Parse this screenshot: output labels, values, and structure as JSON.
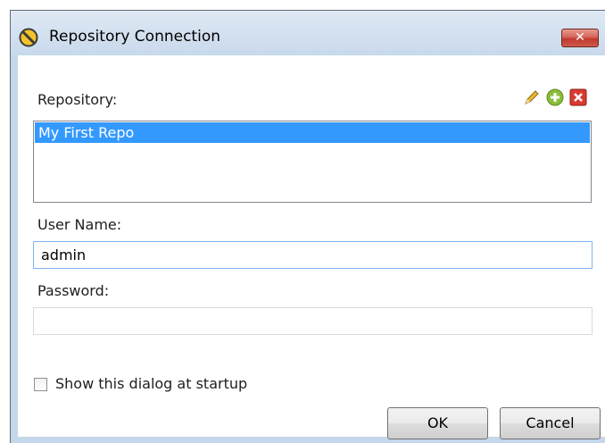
{
  "window": {
    "title": "Repository Connection",
    "close_glyph": "✕"
  },
  "repository": {
    "label": "Repository:",
    "items": [
      "My First Repo"
    ],
    "selected_index": 0,
    "toolbar": {
      "edit_icon": "pencil-icon",
      "add_icon": "plus-circle-icon",
      "delete_icon": "red-x-icon"
    }
  },
  "username": {
    "label": "User Name:",
    "value": "admin"
  },
  "password": {
    "label": "Password:",
    "value": ""
  },
  "startup": {
    "label": "Show this dialog at startup",
    "checked": false
  },
  "buttons": {
    "ok": "OK",
    "cancel": "Cancel"
  },
  "colors": {
    "selection": "#3399ff",
    "title_gradient_top": "#dfe9f4",
    "close_red": "#c1392d"
  }
}
